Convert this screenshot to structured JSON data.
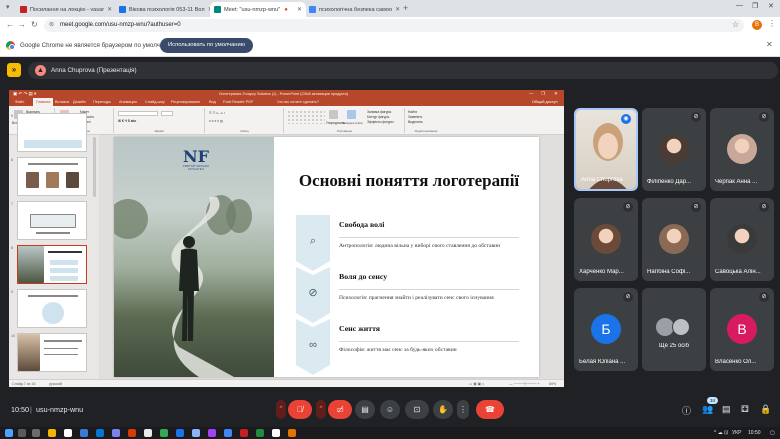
{
  "browser": {
    "tabs": [
      {
        "title": "Посилання на лекцію - vasar",
        "favicon_color": "#c5221f",
        "active": false
      },
      {
        "title": "Вікова психологія 053-11 Вол",
        "favicon_color": "#1a73e8",
        "active": false
      },
      {
        "title": "Meet: \"usu-nmzp-wnu\"",
        "favicon_color": "#00897b",
        "active": true
      },
      {
        "title": "психологічна безпека самоо",
        "favicon_color": "#4285f4",
        "active": false
      }
    ],
    "new_tab_symbol": "+",
    "url": "meet.google.com/usu-nmzp-wnu?authuser=0",
    "profile_initial": "B",
    "infobar": {
      "message": "Google Chrome не является браузером по умолчанию.",
      "button": "Использовать по умолчанию"
    }
  },
  "meet": {
    "presenter_label": "Anna Chuprova (Презентація)",
    "meeting_time": "10:50",
    "meeting_code": "usu-nmzp-wnu",
    "participant_count_badge": "34",
    "participants": [
      {
        "name": "Anna Chuprova",
        "initial": "",
        "speaking": true,
        "avatar_color": "#d9b48f"
      },
      {
        "name": "Філіпенко Дар...",
        "initial": "",
        "speaking": false,
        "avatar_color": "#4a3b34"
      },
      {
        "name": "Черпак Анна ...",
        "initial": "",
        "speaking": false,
        "avatar_color": "#c9a89a"
      },
      {
        "name": "Харченко Мар...",
        "initial": "",
        "speaking": false,
        "avatar_color": "#6b4a3a"
      },
      {
        "name": "Нагібіна Софі...",
        "initial": "",
        "speaking": false,
        "avatar_color": "#8a6a55"
      },
      {
        "name": "Савоцька Алін...",
        "initial": "",
        "speaking": false,
        "avatar_color": "#3a3a3a"
      },
      {
        "name": "Белая Юліана ...",
        "initial": "Б",
        "speaking": false,
        "avatar_color": "#1a73e8"
      },
      {
        "name": "Ще 25 осіб",
        "initial": "",
        "speaking": false,
        "avatar_color": "#5f6368"
      },
      {
        "name": "Власенко Ол...",
        "initial": "В",
        "speaking": false,
        "avatar_color": "#d81b60"
      }
    ]
  },
  "powerpoint": {
    "document_title": "Логотерапия-Тогарсу Sokatus (1) - PowerPoint (Сбой активации продукта)",
    "menu": [
      "Файл",
      "Главная",
      "Вставка",
      "Дизайн",
      "Переходы",
      "Анимация",
      "Слайд-шоу",
      "Рецензирование",
      "Вид",
      "Foxit Reader PDF",
      "Что вы хотите сделать?"
    ],
    "active_menu": "Главная",
    "share_label": "Общий доступ",
    "ribbon_groups": [
      "Буфер обмена",
      "Слайды",
      "Шрифт",
      "Абзац",
      "Рисование",
      "Редактирование"
    ],
    "ribbon_items": {
      "paste": "Вставить",
      "cut": "Вырезать",
      "copy": "Копировать",
      "format_painter": "Формат по образцу",
      "new_slide": "Создать слайд",
      "layout": "Макет",
      "reset": "Сбросить",
      "section": "Раздел",
      "arrange": "Упорядочить",
      "quick_styles": "Экспресс-стили",
      "shape_fill": "Заливка фигуры",
      "shape_outline": "Контур фигуры",
      "shape_effects": "Эффекты фигуры",
      "find": "Найти",
      "replace": "Заменить",
      "select": "Выделить"
    },
    "thumb_numbers": [
      "5",
      "6",
      "7",
      "8",
      "9",
      "10"
    ],
    "status_left": "Слайд 7 из 16",
    "status_lang": "русский",
    "status_zoom": "69%"
  },
  "slide": {
    "brand_mark": "NF",
    "brand_sub": "СВЯТОЙ МИХАИЛ АРХАНГЕЛ",
    "title": "Основні поняття логотерапії",
    "blocks": [
      {
        "title": "Свобода волі",
        "icon": "search-icon",
        "glyph": "⌕",
        "desc": "Антропологія: людина вільна у виборі свого ставлення до обставин"
      },
      {
        "title": "Воля до сенсу",
        "icon": "compass-icon",
        "glyph": "⊘",
        "desc": "Психологія: прагнення знайти і реалізувати сенс свого існування"
      },
      {
        "title": "Сенс життя",
        "icon": "infinity-icon",
        "glyph": "∞",
        "desc": "Філософія: життя має сенс за будь-яких обставин"
      }
    ]
  },
  "taskbar": {
    "lang": "УКР",
    "time": "10:50"
  },
  "colors": {
    "meet_bg": "#202124",
    "ppt_red": "#b7472a",
    "end_call": "#ea4335",
    "chevron": "#dbe9f1"
  }
}
